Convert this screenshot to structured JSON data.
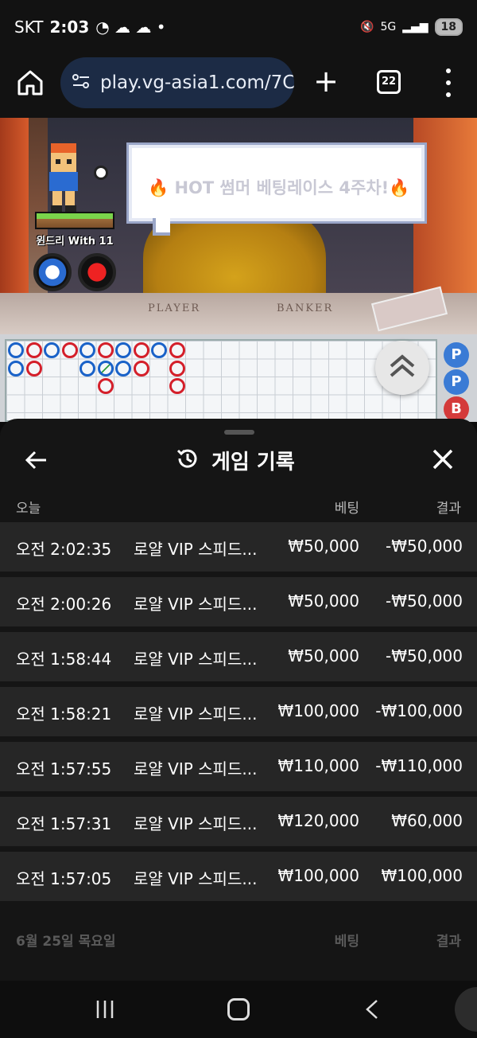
{
  "status_bar": {
    "carrier": "SKT",
    "time": "2:03",
    "network": "5G",
    "battery": "18"
  },
  "browser": {
    "url": "play.vg-asia1.com/7C",
    "tab_count": "22"
  },
  "video": {
    "banner_text": "🔥 HOT 썸머 베팅레이스 4주차!🔥",
    "nickname": "윈드리 With 11",
    "table_player_label": "PLAYER",
    "table_banker_label": "BANKER"
  },
  "roadmap": {
    "side_chips": [
      "P",
      "P",
      "B"
    ],
    "colors": {
      "blue": "#1a62c8",
      "red": "#d41f2a"
    }
  },
  "history": {
    "title": "게임 기록",
    "today_label": "오늘",
    "bet_header": "베팅",
    "result_header": "결과",
    "rows": [
      {
        "time": "오전 2:02:35",
        "game": "로얄 VIP 스피드...",
        "bet": "₩50,000",
        "result": "-₩50,000"
      },
      {
        "time": "오전 2:00:26",
        "game": "로얄 VIP 스피드...",
        "bet": "₩50,000",
        "result": "-₩50,000"
      },
      {
        "time": "오전 1:58:44",
        "game": "로얄 VIP 스피드...",
        "bet": "₩50,000",
        "result": "-₩50,000"
      },
      {
        "time": "오전 1:58:21",
        "game": "로얄 VIP 스피드...",
        "bet": "₩100,000",
        "result": "-₩100,000"
      },
      {
        "time": "오전 1:57:55",
        "game": "로얄 VIP 스피드...",
        "bet": "₩110,000",
        "result": "-₩110,000"
      },
      {
        "time": "오전 1:57:31",
        "game": "로얄 VIP 스피드...",
        "bet": "₩120,000",
        "result": "₩60,000"
      },
      {
        "time": "오전 1:57:05",
        "game": "로얄 VIP 스피드...",
        "bet": "₩100,000",
        "result": "₩100,000"
      }
    ],
    "next_day_label": "6월 25일 목요일",
    "next_bet_header": "베팅",
    "next_result_header": "결과"
  }
}
